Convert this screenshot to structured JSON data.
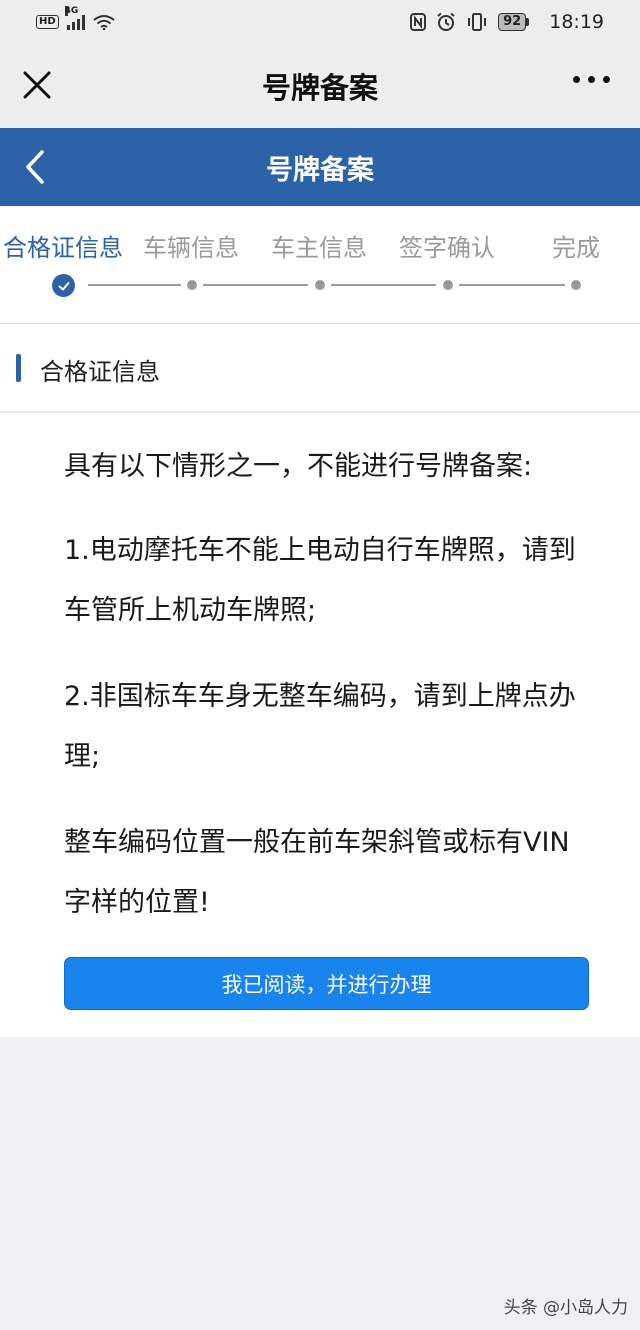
{
  "status_bar": {
    "hd": "HD",
    "network": "4G",
    "battery": "92",
    "time": "18:19"
  },
  "wechat_header": {
    "title": "号牌备案"
  },
  "page_nav": {
    "title": "号牌备案"
  },
  "steps": [
    {
      "label": "合格证信息",
      "state": "done"
    },
    {
      "label": "车辆信息",
      "state": "pending"
    },
    {
      "label": "车主信息",
      "state": "pending"
    },
    {
      "label": "签字确认",
      "state": "pending"
    },
    {
      "label": "完成",
      "state": "pending"
    }
  ],
  "section": {
    "title": "合格证信息"
  },
  "notice": {
    "intro": "具有以下情形之一，不能进行号牌备案:",
    "item1": "1.电动摩托车不能上电动自行车牌照，请到车管所上机动车牌照;",
    "item2": "2.非国标车车身无整车编码，请到上牌点办理;",
    "tip": "整车编码位置一般在前车架斜管或标有VIN字样的位置!"
  },
  "confirm_button": {
    "label": "我已阅读，并进行办理"
  },
  "watermark": {
    "text": "头条 @小岛人力"
  },
  "colors": {
    "primary": "#2c63a8",
    "button": "#1a84ee",
    "inactive": "#9a9a9a"
  }
}
